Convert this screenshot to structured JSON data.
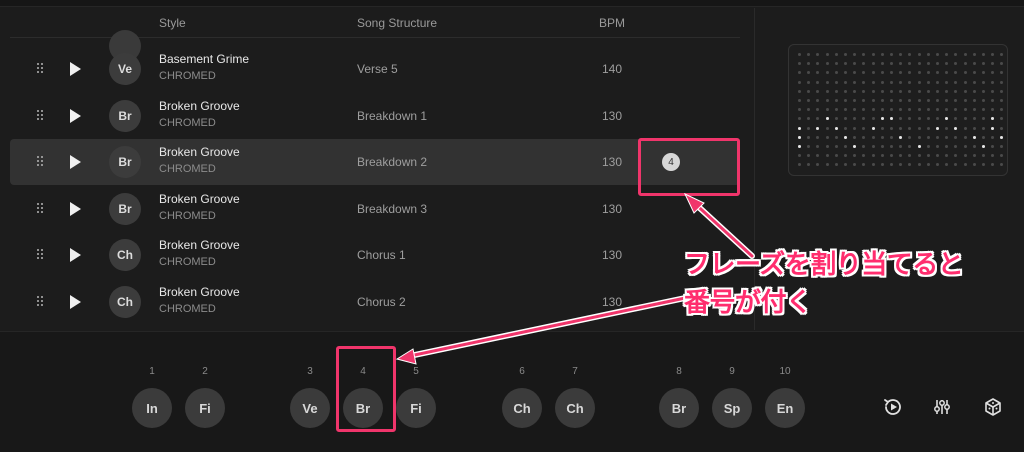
{
  "table": {
    "columns": {
      "style": "Style",
      "structure": "Song Structure",
      "bpm": "BPM"
    },
    "rows": [
      {
        "avatar": "Ve",
        "name": "Basement Grime",
        "label": "CHROMED",
        "structure": "Verse 5",
        "bpm": "140",
        "selected": false,
        "assigned": ""
      },
      {
        "avatar": "Br",
        "name": "Broken Groove",
        "label": "CHROMED",
        "structure": "Breakdown 1",
        "bpm": "130",
        "selected": false,
        "assigned": ""
      },
      {
        "avatar": "Br",
        "name": "Broken Groove",
        "label": "CHROMED",
        "structure": "Breakdown 2",
        "bpm": "130",
        "selected": true,
        "assigned": "4"
      },
      {
        "avatar": "Br",
        "name": "Broken Groove",
        "label": "CHROMED",
        "structure": "Breakdown 3",
        "bpm": "130",
        "selected": false,
        "assigned": ""
      },
      {
        "avatar": "Ch",
        "name": "Broken Groove",
        "label": "CHROMED",
        "structure": "Chorus 1",
        "bpm": "130",
        "selected": false,
        "assigned": ""
      },
      {
        "avatar": "Ch",
        "name": "Broken Groove",
        "label": "CHROMED",
        "structure": "Chorus 2",
        "bpm": "130",
        "selected": false,
        "assigned": ""
      }
    ]
  },
  "pads": [
    {
      "num": "1",
      "label": "In"
    },
    {
      "num": "2",
      "label": "Fi"
    },
    {
      "num": "3",
      "label": "Ve"
    },
    {
      "num": "4",
      "label": "Br"
    },
    {
      "num": "5",
      "label": "Fi"
    },
    {
      "num": "6",
      "label": "Ch"
    },
    {
      "num": "7",
      "label": "Ch"
    },
    {
      "num": "8",
      "label": "Br"
    },
    {
      "num": "9",
      "label": "Sp"
    },
    {
      "num": "10",
      "label": "En"
    }
  ],
  "tools": [
    {
      "icon": "reload-play-icon"
    },
    {
      "icon": "sliders-icon"
    },
    {
      "icon": "dice-icon"
    }
  ],
  "annotation": {
    "line1": "フレーズを割り当てると",
    "line2": "番号が付く",
    "color": "#f0356b"
  },
  "colors": {
    "background": "#1c1c1c",
    "selected_row": "#323232",
    "pad": "#3b3b3b",
    "accent": "#f0356b"
  }
}
